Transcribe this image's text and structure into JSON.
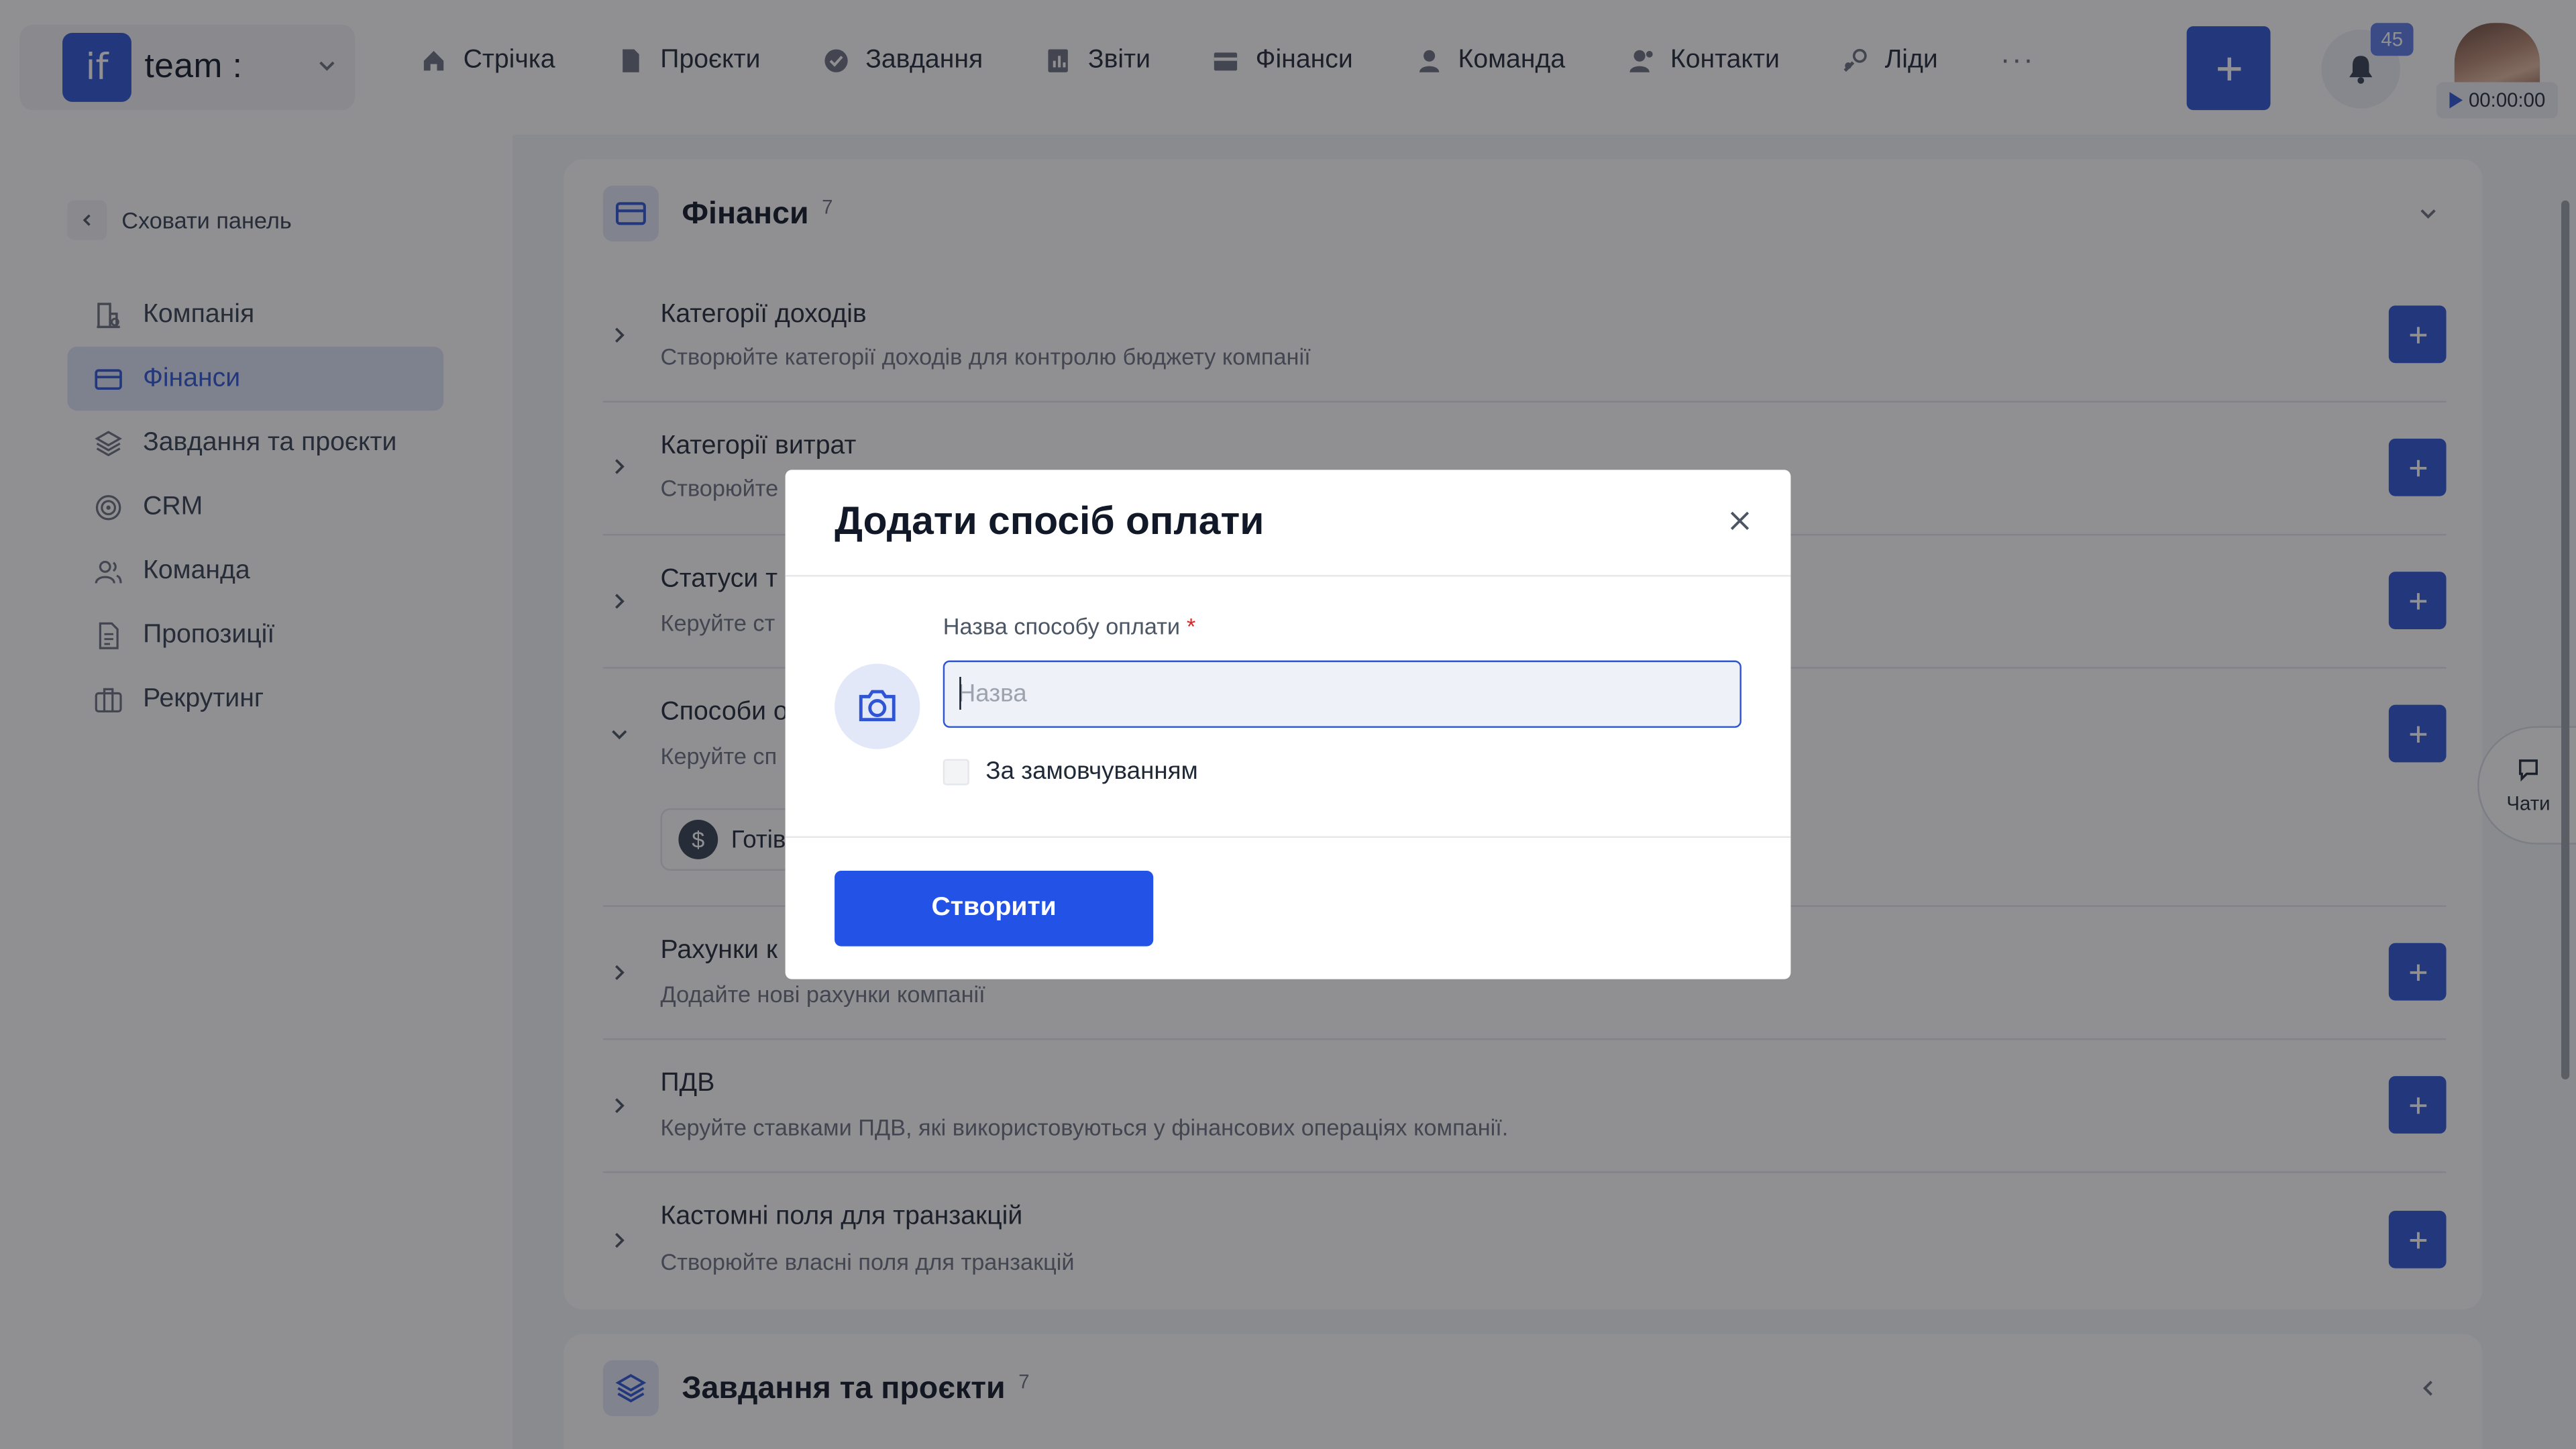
{
  "app": {
    "brand_logo": "if",
    "brand_name": "team :"
  },
  "nav": {
    "items": [
      "Стрічка",
      "Проєкти",
      "Завдання",
      "Звіти",
      "Фінанси",
      "Команда",
      "Контакти",
      "Ліди"
    ],
    "more": "···"
  },
  "header": {
    "notifications_count": "45",
    "timer": "00:00:00"
  },
  "sidebar": {
    "hide_label": "Сховати панель",
    "items": [
      "Компанія",
      "Фінанси",
      "Завдання та проєкти",
      "CRM",
      "Команда",
      "Пропозиції",
      "Рекрутинг"
    ],
    "active_index": 1
  },
  "main": {
    "section_title": "Фінанси",
    "section_count": "7",
    "rows": [
      {
        "title": "Категорії доходів",
        "desc": "Створюйте категорії доходів для контролю бюджету компанії"
      },
      {
        "title": "Категорії витрат",
        "desc": "Створюйте"
      },
      {
        "title": "Статуси т",
        "desc": "Керуйте ст"
      },
      {
        "title": "Способи о",
        "desc": "Керуйте сп",
        "chip": "Готів"
      },
      {
        "title": "Рахунки к",
        "desc": "Додайте нові рахунки компанії"
      },
      {
        "title": "ПДВ",
        "desc": "Керуйте ставками ПДВ, які використовуються у фінансових операціях компанії."
      },
      {
        "title": "Кастомні поля для транзакцій",
        "desc": "Створюйте власні поля для транзакцій"
      }
    ],
    "next_section_title": "Завдання та проєкти",
    "next_section_count": "7"
  },
  "chats_label": "Чати",
  "modal": {
    "title": "Додати спосіб оплати",
    "field_label": "Назва способу оплати",
    "field_required": "*",
    "field_placeholder": "Назва",
    "field_value": "",
    "default_label": "За замовчуванням",
    "default_checked": false,
    "submit_label": "Створити"
  },
  "colors": {
    "accent": "#2f55d4",
    "primary_button": "#2352e6",
    "overlay": "rgba(22,24,29,0.48)"
  }
}
